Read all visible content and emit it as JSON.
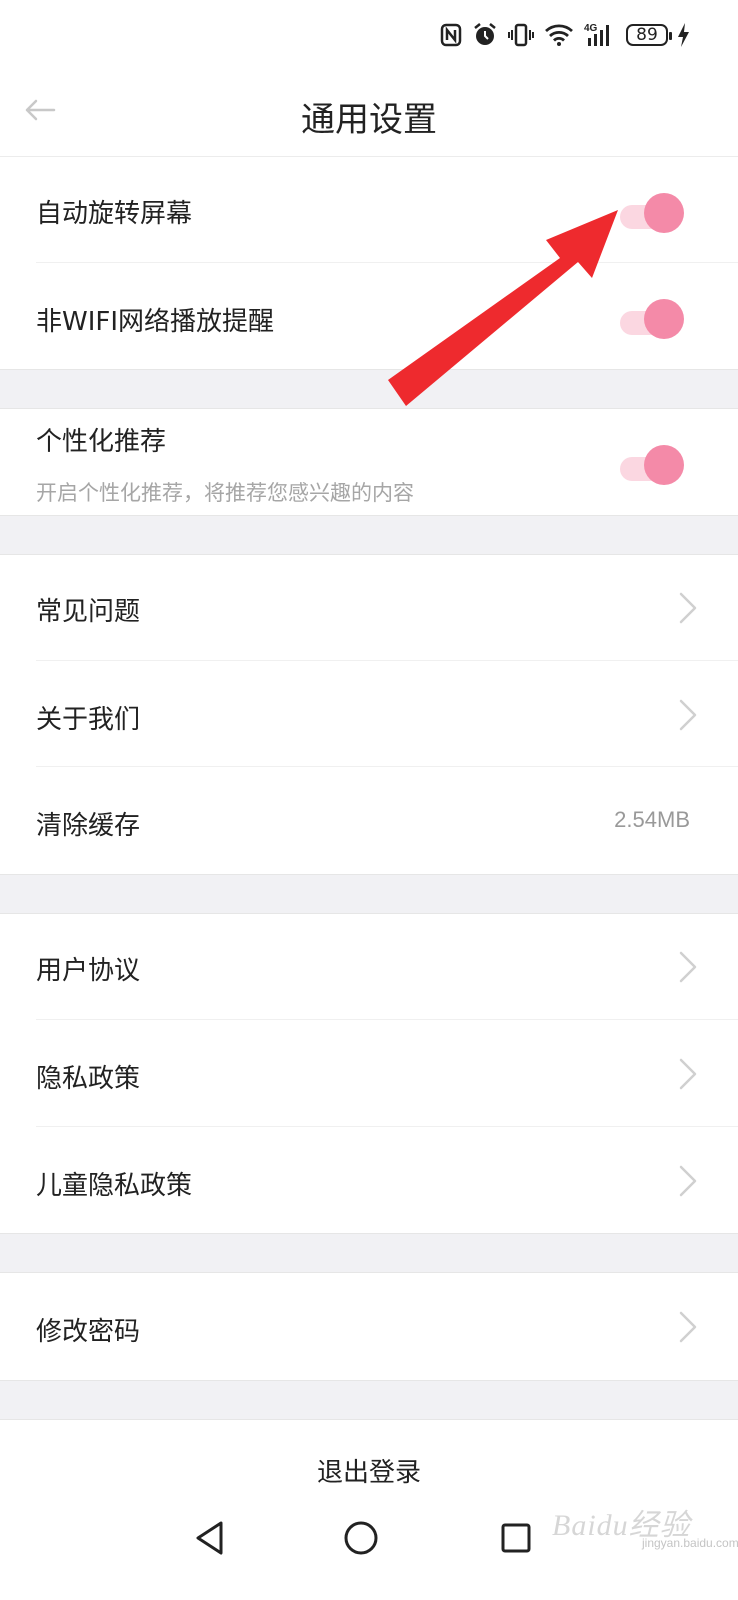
{
  "status_bar": {
    "icons": [
      "nfc-icon",
      "alarm-icon",
      "vibrate-icon",
      "wifi-icon",
      "signal-4g-icon",
      "battery-icon",
      "charging-icon"
    ],
    "network": "4G",
    "battery_level": "89"
  },
  "header": {
    "title": "通用设置",
    "back_icon": "back-arrow-icon"
  },
  "settings": {
    "auto_rotate": {
      "label": "自动旋转屏幕",
      "enabled": true
    },
    "non_wifi_alert": {
      "label": "非WIFI网络播放提醒",
      "enabled": true
    },
    "personalized": {
      "label": "个性化推荐",
      "description": "开启个性化推荐，将推荐您感兴趣的内容",
      "enabled": true
    },
    "faq": {
      "label": "常见问题"
    },
    "about": {
      "label": "关于我们"
    },
    "clear_cache": {
      "label": "清除缓存",
      "value": "2.54MB"
    },
    "user_agreement": {
      "label": "用户协议"
    },
    "privacy_policy": {
      "label": "隐私政策"
    },
    "child_privacy": {
      "label": "儿童隐私政策"
    },
    "change_password": {
      "label": "修改密码"
    }
  },
  "logout_label": "退出登录",
  "nav": {
    "back_icon": "triangle-back-icon",
    "home_icon": "circle-home-icon",
    "recents_icon": "square-recents-icon"
  },
  "watermark": {
    "text": "Baidu经验",
    "sub": "jingyan.baidu.com"
  },
  "colors": {
    "toggle_knob": "#f48aa8",
    "toggle_track": "#fbd7e1",
    "annotation_arrow": "#ee2a2e",
    "section_gap": "#f1f1f4"
  }
}
